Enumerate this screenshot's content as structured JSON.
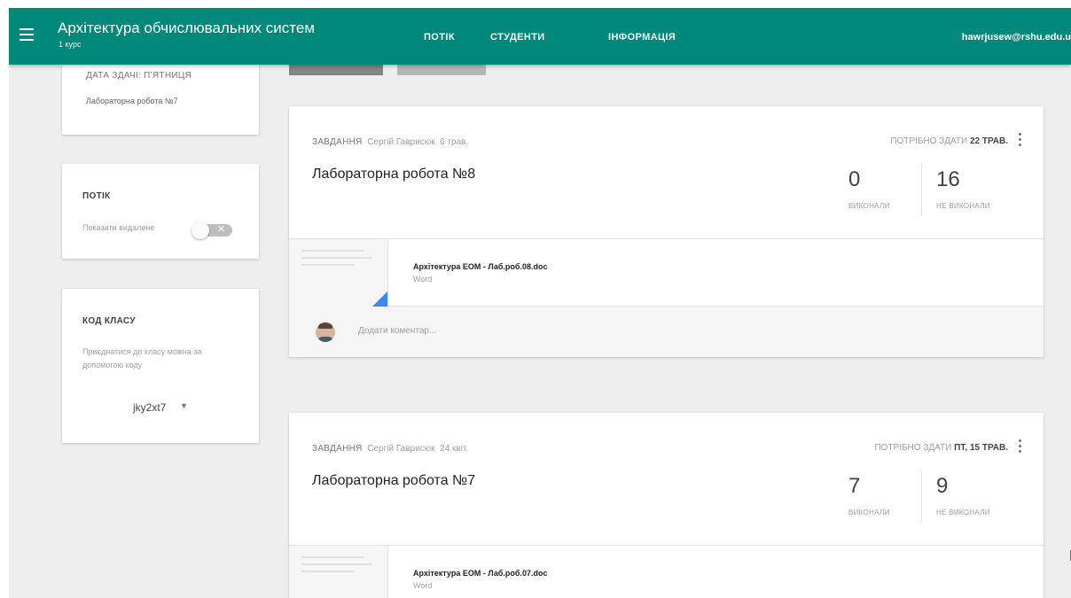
{
  "header": {
    "title": "Архітектура обчислювальних систем",
    "subtitle": "1 курс",
    "tabs": [
      {
        "label": "ПОТІК"
      },
      {
        "label": "СТУДЕНТИ"
      },
      {
        "label": "ІНФОРМАЦІЯ"
      }
    ],
    "user_email": "hawrjusew@rshu.edu.u"
  },
  "sidebar": {
    "upcoming": {
      "due_label": "ДАТА ЗДАЧІ: П'ЯТНИЦЯ",
      "item": "Лабораторна робота №7"
    },
    "stream": {
      "title": "ПОТІК",
      "show_deleted_label": "Показати видалене",
      "toggle_on": false
    },
    "class_code": {
      "title": "КОД КЛАСУ",
      "description": "Приєднатися до класу можна за допомогою коду",
      "code": "jky2xt7"
    }
  },
  "assignments": [
    {
      "type_label": "ЗАВДАННЯ",
      "author": "Сергій Гаврисюк",
      "date": "6 трав.",
      "title": "Лабораторна робота №8",
      "due_prefix": "ПОТРІБНО ЗДАТИ",
      "due_date": "22 ТРАВ.",
      "done": "0",
      "done_label": "ВИКОНАЛИ",
      "not_done": "16",
      "not_done_label": "НЕ ВИКОНАЛИ",
      "attachment": {
        "name": "Архітектура ЕОМ - Лаб.роб.08.doc",
        "type": "Word"
      },
      "comment_placeholder": "Додати коментар..."
    },
    {
      "type_label": "ЗАВДАННЯ",
      "author": "Сергій Гаврисюк",
      "date": "24 квіт.",
      "title": "Лабораторна робота №7",
      "due_prefix": "ПОТРІБНО ЗДАТИ",
      "due_date": "ПТ, 15 ТРАВ.",
      "done": "7",
      "done_label": "ВИКОНАЛИ",
      "not_done": "9",
      "not_done_label": "НЕ ВИКОНАЛИ",
      "attachment": {
        "name": "Архітектура ЕОМ - Лаб.роб.07.doc",
        "type": "Word"
      }
    }
  ],
  "colors": {
    "brand": "#00897b",
    "background": "#eeeeee",
    "word_accent": "#4285f4"
  },
  "icons": [
    "menu-icon",
    "kebab-menu-icon",
    "word-file-icon",
    "avatar"
  ]
}
